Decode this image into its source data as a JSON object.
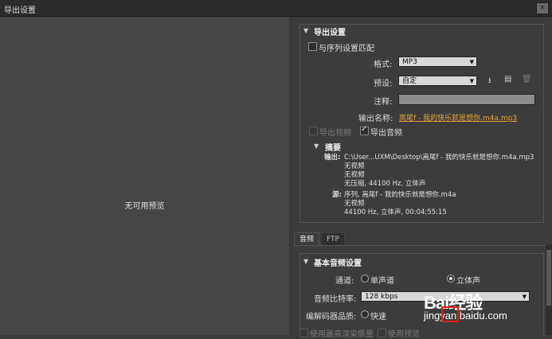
{
  "window": {
    "title": "导出设置",
    "close_icon": "×"
  },
  "preview": {
    "message": "无可用预览"
  },
  "export_settings": {
    "header": "导出设置",
    "match_sequence_label": "与序列设置匹配",
    "match_sequence_checked": false,
    "format_label": "格式:",
    "format_value": "MP3",
    "preset_label": "预设:",
    "preset_value": "自定",
    "comment_label": "注释:",
    "comment_value": "",
    "output_name_label": "输出名称:",
    "output_name_value": "嵩尾f - 我的快乐就是想你.m4a.mp3",
    "export_video_label": "导出视频",
    "export_video_checked": false,
    "export_video_enabled": false,
    "export_audio_label": "导出音频",
    "export_audio_checked": true
  },
  "summary": {
    "header": "摘要",
    "output_label": "输出:",
    "output_lines": [
      "C:\\User...UXM\\Desktop\\嵩尾f - 我的快乐就是想你.m4a.mp3",
      "无视频",
      "无视频",
      "无压缩, 44100 Hz, 立体声"
    ],
    "source_label": "源:",
    "source_lines": [
      "序列, 嵩尾f - 我的快乐就是想你.m4a",
      "无视频",
      "44100 Hz, 立体声, 00:04:55:15"
    ]
  },
  "tabs": [
    {
      "label": "音频",
      "active": true
    },
    {
      "label": "FTP",
      "active": false
    }
  ],
  "basic_audio": {
    "header": "基本音频设置",
    "channels_label": "通道:",
    "mono_label": "单声道",
    "stereo_label": "立体声",
    "bitrate_label": "音频比特率:",
    "bitrate_value": "128 kbps",
    "codec_quality_label": "编解码器品质:",
    "fast_label": "快速",
    "bottom_label_1": "使用最高渲染质量",
    "bottom_label_2": "使用预览"
  },
  "watermark": {
    "brand": "Bai经验",
    "url": "jingyan.baidu.com"
  },
  "colors": {
    "link": "#e8a33a",
    "panel": "#3c3c3c",
    "preview": "#464646"
  }
}
